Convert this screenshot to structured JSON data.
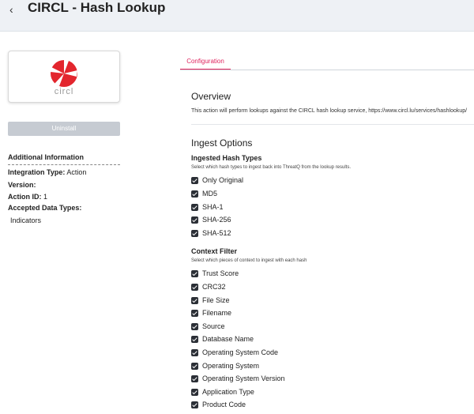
{
  "header": {
    "back_icon": "chevron-left-icon",
    "title": "CIRCL - Hash Lookup"
  },
  "logo": {
    "text": "circl",
    "colors": {
      "primary": "#e3262e",
      "text": "#9a9a9a"
    }
  },
  "sidebar": {
    "uninstall_label": "Uninstall",
    "info_title": "Additional Information",
    "integration_type_label": "Integration Type:",
    "integration_type_value": "Action",
    "version_label": "Version:",
    "action_id_label": "Action ID:",
    "action_id_value": "1",
    "data_types_label": "Accepted Data Types:",
    "data_types_value": "Indicators"
  },
  "tabs": [
    {
      "label": "Configuration",
      "active": true
    }
  ],
  "overview": {
    "title": "Overview",
    "description": "This action will perform lookups against the CIRCL hash lookup service, https://www.circl.lu/services/hashlookup/"
  },
  "ingest": {
    "title": "Ingest Options",
    "hash_types": {
      "title": "Ingested Hash Types",
      "description": "Select which hash types to ingest back into ThreatQ from the lookup results.",
      "options": [
        {
          "label": "Only Original",
          "checked": true
        },
        {
          "label": "MD5",
          "checked": true
        },
        {
          "label": "SHA-1",
          "checked": true
        },
        {
          "label": "SHA-256",
          "checked": true
        },
        {
          "label": "SHA-512",
          "checked": true
        }
      ]
    },
    "context_filter": {
      "title": "Context Filter",
      "description": "Select which pieces of context to ingest with each hash",
      "options": [
        {
          "label": "Trust Score",
          "checked": true
        },
        {
          "label": "CRC32",
          "checked": true
        },
        {
          "label": "File Size",
          "checked": true
        },
        {
          "label": "Filename",
          "checked": true
        },
        {
          "label": "Source",
          "checked": true
        },
        {
          "label": "Database Name",
          "checked": true
        },
        {
          "label": "Operating System Code",
          "checked": true
        },
        {
          "label": "Operating System",
          "checked": true
        },
        {
          "label": "Operating System Version",
          "checked": true
        },
        {
          "label": "Application Type",
          "checked": true
        },
        {
          "label": "Product Code",
          "checked": true
        }
      ]
    }
  },
  "colors": {
    "accent": "#e0245e",
    "checkbox": "#2b2f36",
    "button": "#c6cbd2",
    "header_bg": "#eef1f5"
  }
}
